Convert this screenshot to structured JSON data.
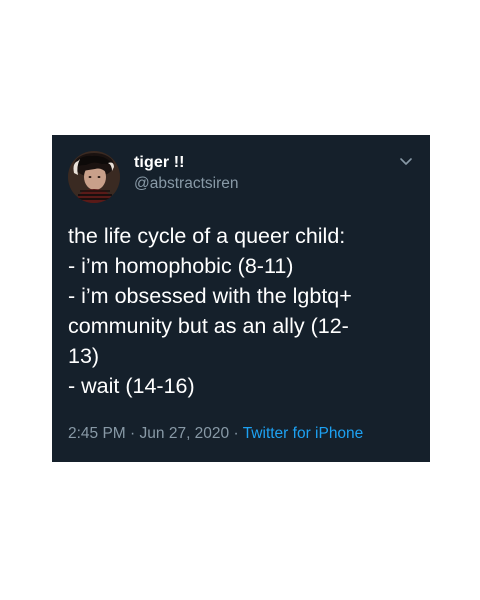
{
  "tweet": {
    "display_name": "tiger !!",
    "handle": "@abstractsiren",
    "menu_icon": "chevron-down-icon",
    "avatar_icon": "profile-photo",
    "lines": [
      "the life cycle of a queer child:",
      "- i’m homophobic (8-11)",
      "- i’m obsessed with the lgbtq+",
      "community but as an ally (12-",
      "13)",
      "- wait (14-16)"
    ],
    "time": "2:45 PM",
    "date": "Jun 27, 2020",
    "separator": "·",
    "source": "Twitter for iPhone"
  },
  "colors": {
    "page_background": "#ffffff",
    "card_background": "#15202b",
    "primary_text": "#ffffff",
    "secondary_text": "#8899a6",
    "link": "#1da1f2"
  }
}
